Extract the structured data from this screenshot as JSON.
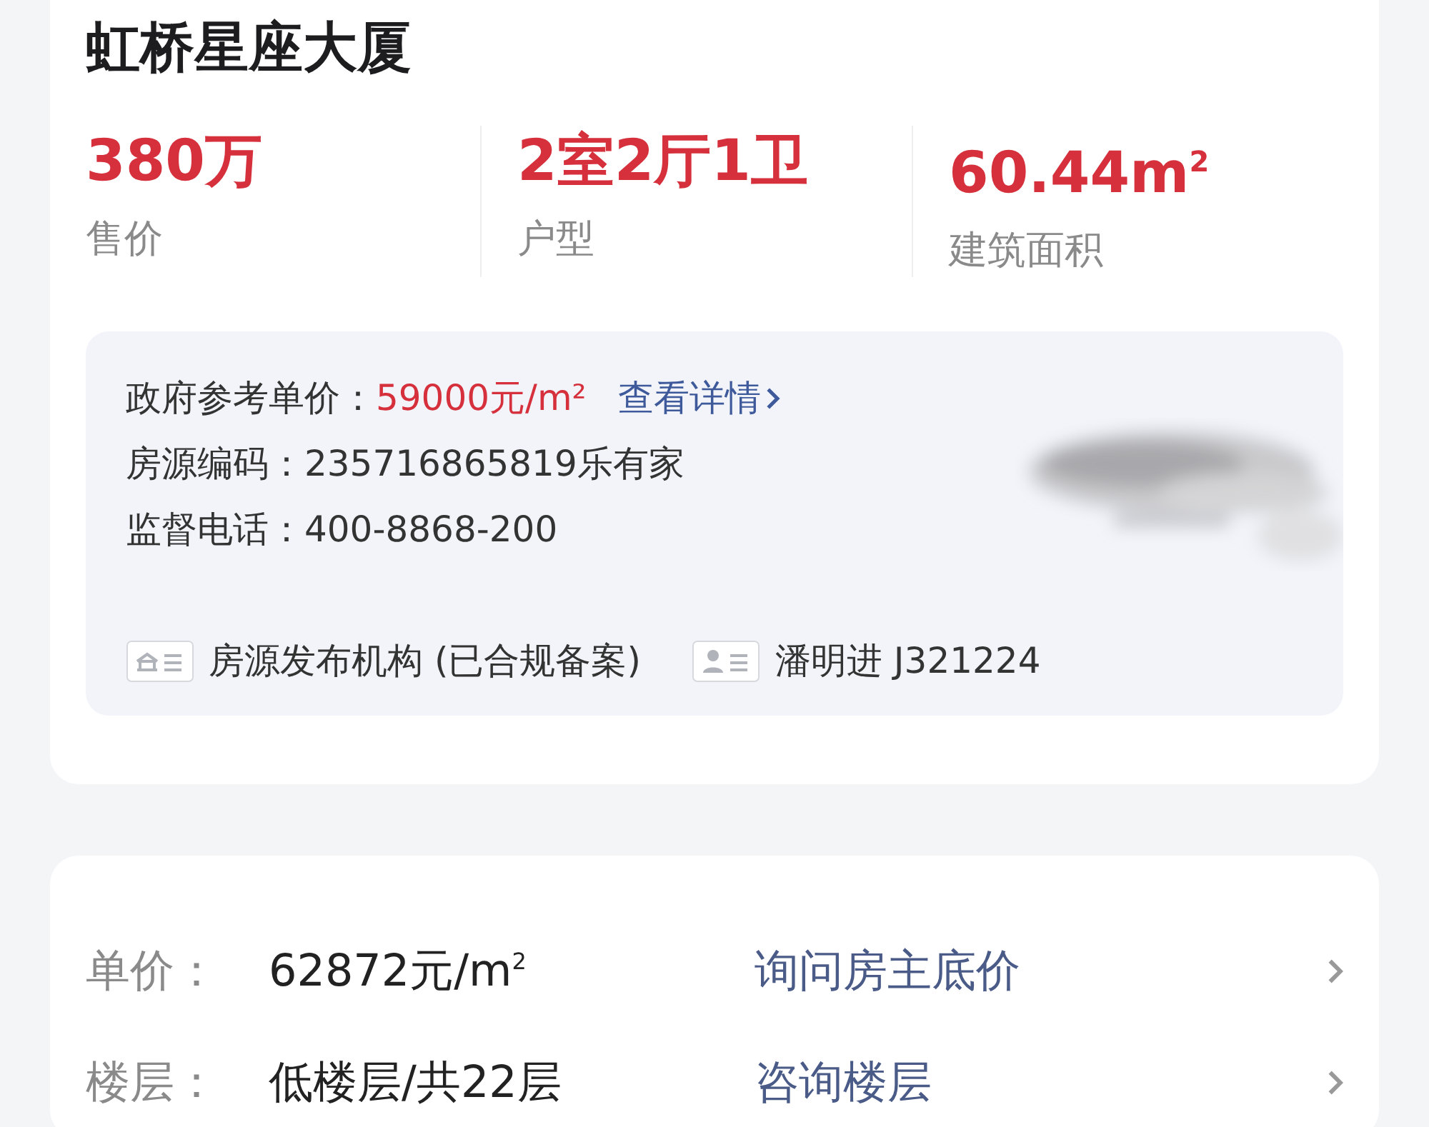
{
  "title": "虹桥星座大厦",
  "stats": [
    {
      "value": "380万",
      "label": "售价"
    },
    {
      "value": "2室2厅1卫",
      "label": "户型"
    },
    {
      "value": "60.44m$^{2}$",
      "label": "建筑面积"
    }
  ],
  "info": {
    "lines": [
      {
        "label": "政府参考单价：",
        "value": "59000元/m²",
        "kind": "price",
        "link": "查看详情"
      },
      {
        "label": "房源编码：",
        "value": "235716865819乐有家",
        "kind": "plain"
      },
      {
        "label": "监督电话：",
        "value": "400-8868-200",
        "kind": "plain"
      }
    ],
    "footer": [
      {
        "kind": "agency",
        "text": "房源发布机构 (已合规备案)"
      },
      {
        "kind": "agent",
        "text": "潘明进 J321224"
      }
    ]
  },
  "details": [
    {
      "label": "单价：",
      "value": "62872元/m$^{2}$",
      "action": "询问房主底价"
    },
    {
      "label": "楼层：",
      "value": "低楼层/共22层",
      "action": "咨询楼层"
    }
  ]
}
